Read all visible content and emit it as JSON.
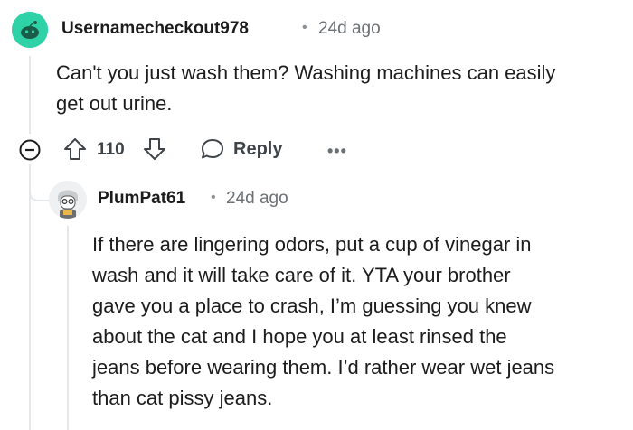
{
  "comment": {
    "username": "Usernamecheckout978",
    "separator": "•",
    "time": "24d ago",
    "body_line1": "Can't you just wash them? Washing machines can easily",
    "body_line2": "get out urine.",
    "votes": "110",
    "reply_label": "Reply",
    "more_label": "•••",
    "avatar_color": "#2fd2a7"
  },
  "reply": {
    "username": "PlumPat61",
    "separator": "•",
    "time": "24d ago",
    "lines": [
      "If there are lingering odors, put a cup of vinegar in",
      "wash and it will take care of it. YTA your brother",
      "gave you a place to crash, I’m guessing you knew",
      "about the cat and I hope you at least rinsed the",
      "jeans before wearing them. I’d rather wear wet jeans",
      "than cat pissy jeans."
    ]
  },
  "icons": {
    "collapse": "collapse-minus-icon",
    "upvote": "upvote-arrow-icon",
    "downvote": "downvote-arrow-icon",
    "reply": "speech-bubble-icon",
    "more": "more-dots-icon"
  }
}
